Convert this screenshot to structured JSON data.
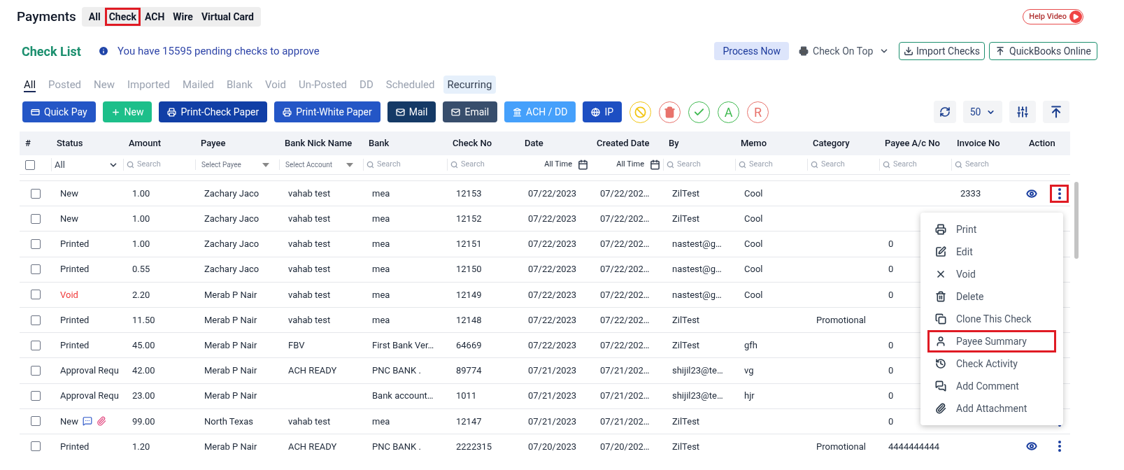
{
  "header": {
    "title": "Payments",
    "payment_tabs": [
      {
        "label": "All",
        "highlighted": false
      },
      {
        "label": "Check",
        "highlighted": true
      },
      {
        "label": "ACH",
        "highlighted": false
      },
      {
        "label": "Wire",
        "highlighted": false
      },
      {
        "label": "Virtual Card",
        "highlighted": false
      }
    ],
    "help_button": "Help Video"
  },
  "list_bar": {
    "title": "Check List",
    "notice": "You have 15595 pending checks to approve",
    "process_button": "Process Now",
    "print_mode": "Check On Top",
    "import_button": "Import Checks",
    "quickbooks_button": "QuickBooks Online"
  },
  "status_tabs": [
    {
      "label": "All",
      "selected": true,
      "emphasized": false
    },
    {
      "label": "Posted",
      "selected": false,
      "emphasized": false
    },
    {
      "label": "New",
      "selected": false,
      "emphasized": false
    },
    {
      "label": "Imported",
      "selected": false,
      "emphasized": false
    },
    {
      "label": "Mailed",
      "selected": false,
      "emphasized": false
    },
    {
      "label": "Blank",
      "selected": false,
      "emphasized": false
    },
    {
      "label": "Void",
      "selected": false,
      "emphasized": false
    },
    {
      "label": "Un-Posted",
      "selected": false,
      "emphasized": false
    },
    {
      "label": "DD",
      "selected": false,
      "emphasized": false
    },
    {
      "label": "Scheduled",
      "selected": false,
      "emphasized": false
    },
    {
      "label": "Recurring",
      "selected": false,
      "emphasized": true
    }
  ],
  "toolbar": {
    "buttons": [
      {
        "kind": "quickpay",
        "label": "Quick Pay",
        "color": "#2456c6"
      },
      {
        "kind": "new",
        "label": "New",
        "color": "#1dbf8a"
      },
      {
        "kind": "print",
        "label": "Print-Check Paper",
        "color": "#113fa6"
      },
      {
        "kind": "print",
        "label": "Print-White Paper",
        "color": "#2456c6"
      },
      {
        "kind": "mail",
        "label": "Mail",
        "color": "#153a66"
      },
      {
        "kind": "mail",
        "label": "Email",
        "color": "#384e6c"
      },
      {
        "kind": "bank",
        "label": "ACH / DD",
        "color": "#45a0fb"
      },
      {
        "kind": "globe",
        "label": "IP",
        "color": "#1d4fc2"
      }
    ],
    "round_buttons": [
      {
        "kind": "ban",
        "color": "#f2c511"
      },
      {
        "kind": "trash",
        "color": "#e8736c"
      },
      {
        "kind": "check",
        "color": "#3fb950"
      },
      {
        "kind": "letter",
        "label": "A",
        "color": "#3fb950"
      },
      {
        "kind": "letter",
        "label": "R",
        "color": "#e8736c"
      }
    ],
    "page_size": "50"
  },
  "table": {
    "columns": [
      "#",
      "Status",
      "Amount",
      "Payee",
      "Bank Nick Name",
      "Bank",
      "Check No",
      "Date",
      "Created Date",
      "By",
      "Memo",
      "Category",
      "Payee A/c No",
      "Invoice No",
      "Action"
    ],
    "filters": [
      {
        "kind": "checkbox",
        "checked": false
      },
      {
        "kind": "select",
        "value": "All"
      },
      {
        "kind": "search",
        "placeholder": "Search"
      },
      {
        "kind": "dropdown",
        "placeholder": "Select Payee"
      },
      {
        "kind": "dropdown",
        "placeholder": "Select Account"
      },
      {
        "kind": "search",
        "placeholder": "Search"
      },
      {
        "kind": "search",
        "placeholder": "Search"
      },
      {
        "kind": "date",
        "value": "All Time"
      },
      {
        "kind": "date",
        "value": "All Time"
      },
      {
        "kind": "search",
        "placeholder": "Search"
      },
      {
        "kind": "search",
        "placeholder": "Search"
      },
      {
        "kind": "search",
        "placeholder": "Search"
      },
      {
        "kind": "search",
        "placeholder": "Search"
      },
      {
        "kind": "search",
        "placeholder": "Search"
      },
      {
        "kind": "empty"
      }
    ],
    "rows": [
      {
        "checked": false,
        "void": false,
        "view_button": true,
        "menu_button": true,
        "menu_highlighted": true,
        "cells": [
          "",
          "New",
          "1.00",
          "Zachary Jaco",
          "vahab test",
          "mea",
          "12153",
          "07/22/2023",
          "07/22/202…",
          "ZilTest",
          "Cool",
          "",
          "",
          "2333"
        ]
      },
      {
        "checked": false,
        "void": false,
        "cells": [
          "",
          "New",
          "1.00",
          "Zachary Jaco",
          "vahab test",
          "mea",
          "12152",
          "07/22/2023",
          "07/22/202…",
          "ZilTest",
          "Cool",
          "",
          "",
          ""
        ]
      },
      {
        "checked": false,
        "void": false,
        "cells": [
          "",
          "Printed",
          "1.00",
          "Zachary Jaco",
          "vahab test",
          "mea",
          "12151",
          "07/22/2023",
          "07/22/202…",
          "nastest@g…",
          "Cool",
          "",
          "0",
          ""
        ]
      },
      {
        "checked": false,
        "void": false,
        "cells": [
          "",
          "Printed",
          "0.55",
          "Zachary Jaco",
          "vahab test",
          "mea",
          "12150",
          "07/22/2023",
          "07/22/202…",
          "nastest@g…",
          "Cool",
          "",
          "0",
          ""
        ]
      },
      {
        "checked": false,
        "void": true,
        "cells": [
          "",
          "Void",
          "2.20",
          "Merab P Nair",
          "vahab test",
          "mea",
          "12149",
          "07/22/2023",
          "07/22/202…",
          "nastest@g…",
          "Cool",
          "",
          "0",
          ""
        ]
      },
      {
        "checked": false,
        "void": false,
        "cells": [
          "",
          "Printed",
          "11.50",
          "Merab P Nair",
          "vahab test",
          "mea",
          "12148",
          "07/22/2023",
          "07/22/202…",
          "ZilTest",
          "",
          "Promotional",
          "",
          ""
        ]
      },
      {
        "checked": false,
        "void": false,
        "cells": [
          "",
          "Printed",
          "45.00",
          "Merab P Nair",
          "FBV",
          "First Bank Ver…",
          "64669",
          "07/22/2023",
          "07/22/202…",
          "ZilTest",
          "gfh",
          "",
          "0",
          ""
        ]
      },
      {
        "checked": false,
        "void": false,
        "cells": [
          "",
          "Approval Requ",
          "42.00",
          "Merab P Nair",
          "ACH READY",
          "PNC BANK .",
          "89774",
          "07/21/2023",
          "07/21/202…",
          "shijil23@te…",
          "vg",
          "",
          "0",
          ""
        ]
      },
      {
        "checked": false,
        "void": false,
        "cells": [
          "",
          "Approval Requ",
          "23.00",
          "Merab P Nair",
          "",
          "Bank account…",
          "1011",
          "07/21/2023",
          "07/21/202…",
          "shijil23@te…",
          "hjr",
          "",
          "0",
          ""
        ]
      },
      {
        "checked": false,
        "void": false,
        "comment": true,
        "attachment": true,
        "menu_button": true,
        "menu_highlighted": false,
        "cells": [
          "",
          "New",
          "99.00",
          "North Texas",
          "vahab test",
          "mea",
          "12147",
          "07/21/2023",
          "07/21/202…",
          "ZilTest",
          "",
          "",
          "0",
          ""
        ]
      },
      {
        "checked": false,
        "void": false,
        "view_button": true,
        "menu_button": true,
        "menu_highlighted": false,
        "cells": [
          "",
          "Printed",
          "1.20",
          "Merab P Nair",
          "ACH READY",
          "PNC BANK .",
          "2222315",
          "07/20/2023",
          "07/20/202…",
          "ZilTest",
          "",
          "Promotional",
          "4444444444",
          ""
        ]
      }
    ]
  },
  "action_menu": [
    {
      "kind": "print",
      "label": "Print",
      "highlighted": false
    },
    {
      "kind": "edit",
      "label": "Edit",
      "highlighted": false
    },
    {
      "kind": "void",
      "label": "Void",
      "highlighted": false
    },
    {
      "kind": "delete",
      "label": "Delete",
      "highlighted": false
    },
    {
      "kind": "clone",
      "label": "Clone This Check",
      "highlighted": false
    },
    {
      "kind": "person",
      "label": "Payee Summary",
      "highlighted": true
    },
    {
      "kind": "history",
      "label": "Check Activity",
      "highlighted": false
    },
    {
      "kind": "comment",
      "label": "Add Comment",
      "highlighted": false
    },
    {
      "kind": "attach",
      "label": "Add Attachment",
      "highlighted": false
    }
  ]
}
